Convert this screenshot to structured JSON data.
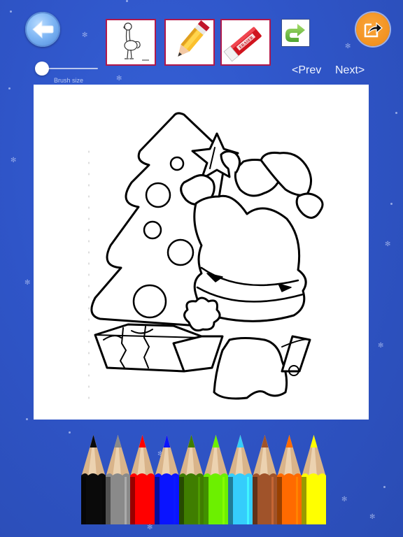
{
  "toolbar": {
    "back_button": {
      "icon": "back-arrow-icon"
    },
    "tools": [
      {
        "name": "picture-picker",
        "icon": "ostrich-thumbnail-icon"
      },
      {
        "name": "pencil-tool",
        "icon": "pencil-icon"
      },
      {
        "name": "eraser-tool",
        "icon": "eraser-icon",
        "eraser_text": "ERASER"
      }
    ],
    "redo_button": {
      "icon": "redo-arrow-icon"
    },
    "share_button": {
      "icon": "share-icon"
    }
  },
  "brush": {
    "label": "Brush size",
    "value_fraction": 0.0
  },
  "navigation": {
    "prev_label": "<Prev",
    "next_label": "Next>"
  },
  "canvas": {
    "image": "santa-christmas-tree-coloring-page"
  },
  "palette": {
    "colors": [
      {
        "name": "black",
        "hex": "#0a0a0a"
      },
      {
        "name": "gray",
        "hex": "#8a8a8a"
      },
      {
        "name": "red",
        "hex": "#ff0000"
      },
      {
        "name": "blue",
        "hex": "#0a14ff"
      },
      {
        "name": "dark-green",
        "hex": "#3f7d00"
      },
      {
        "name": "lime-green",
        "hex": "#6cf000"
      },
      {
        "name": "sky-blue",
        "hex": "#35cdfb"
      },
      {
        "name": "brown",
        "hex": "#a0532a"
      },
      {
        "name": "orange",
        "hex": "#ff6a00"
      },
      {
        "name": "yellow",
        "hex": "#ffff00"
      }
    ]
  },
  "theme": {
    "background": "#2f55c8",
    "tool_border": "#b0184a",
    "share_orange": "#f29221"
  }
}
